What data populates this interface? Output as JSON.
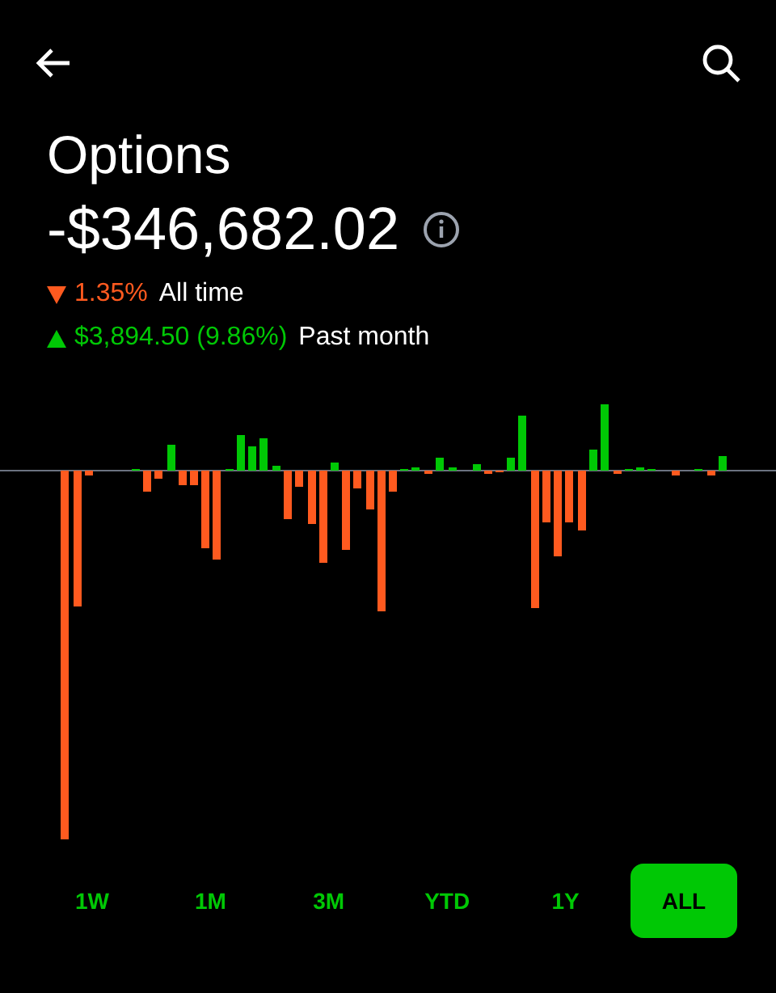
{
  "header": {
    "title": "Options",
    "value": "-$346,682.02"
  },
  "changes": [
    {
      "kind": "loss",
      "amount": "1.35%",
      "label": "All time"
    },
    {
      "kind": "gain",
      "amount": "$3,894.50 (9.86%)",
      "label": "Past month"
    }
  ],
  "ranges": [
    {
      "label": "1W",
      "selected": false
    },
    {
      "label": "1M",
      "selected": false
    },
    {
      "label": "3M",
      "selected": false
    },
    {
      "label": "YTD",
      "selected": false
    },
    {
      "label": "1Y",
      "selected": false
    },
    {
      "label": "ALL",
      "selected": true
    }
  ]
}
